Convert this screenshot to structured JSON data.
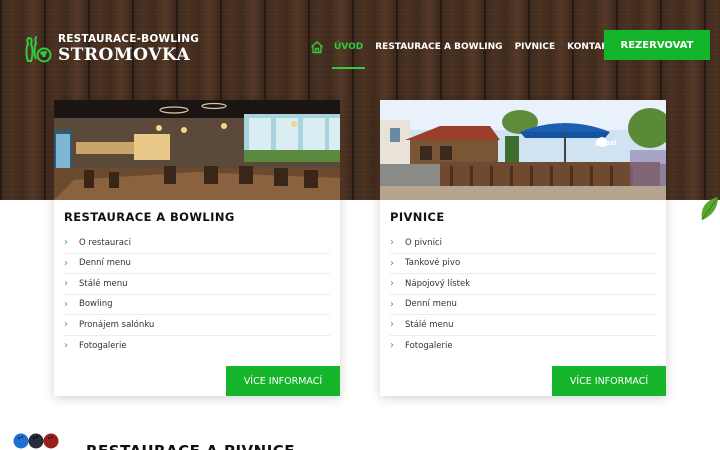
{
  "logo": {
    "line1": "RESTAURACE-BOWLING",
    "line2": "STROMOVKA",
    "icon": "bowling-pins-icon"
  },
  "nav": {
    "home_icon": "home-icon",
    "items": [
      {
        "label": "ÚVOD",
        "active": true
      },
      {
        "label": "RESTAURACE A BOWLING",
        "active": false
      },
      {
        "label": "PIVNICE",
        "active": false
      },
      {
        "label": "KONTAKT",
        "active": false
      }
    ],
    "cta_label": "REZERVOVAT"
  },
  "colors": {
    "accent": "#14b52a",
    "accent_text": "#2ecc40"
  },
  "cards": [
    {
      "title": "RESTAURACE A BOWLING",
      "items": [
        "O restauraci",
        "Denní menu",
        "Stálé menu",
        "Bowling",
        "Pronájem salónku",
        "Fotogalerie"
      ],
      "button": "VÍCE INFORMACÍ"
    },
    {
      "title": "PIVNICE",
      "items": [
        "O pivnici",
        "Tankové pivo",
        "Nápojový lístek",
        "Denní menu",
        "Stálé menu",
        "Fotogalerie"
      ],
      "button": "VÍCE INFORMACÍ",
      "image_text": "pepsi"
    }
  ],
  "bottom_heading": "RESTAURACE A PIVNICE"
}
